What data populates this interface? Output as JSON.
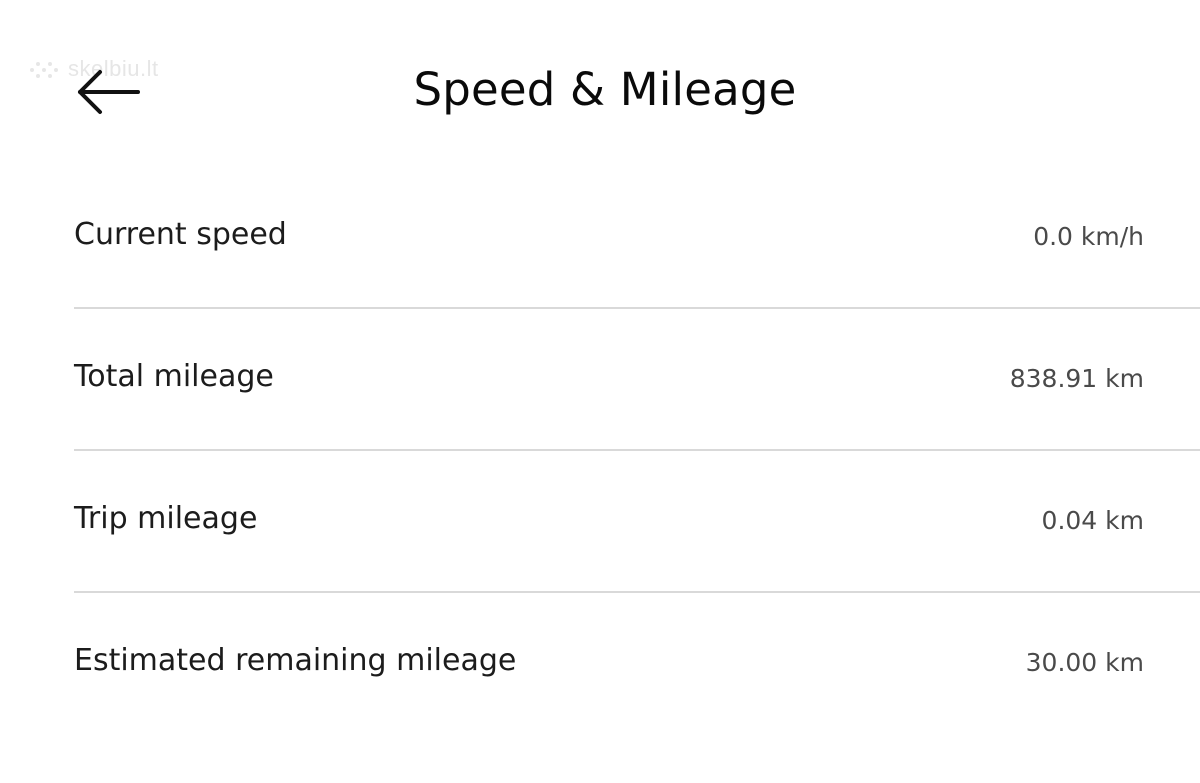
{
  "header": {
    "title": "Speed & Mileage",
    "back_icon": "arrow-left-icon",
    "watermark": "skelbiu.lt"
  },
  "rows": [
    {
      "label": "Current speed",
      "value": "0.0 km/h"
    },
    {
      "label": "Total mileage",
      "value": "838.91 km"
    },
    {
      "label": "Trip mileage",
      "value": "0.04 km"
    },
    {
      "label": "Estimated remaining mileage",
      "value": "30.00 km"
    }
  ],
  "colors": {
    "background": "#ffffff",
    "text_primary": "#111111",
    "text_secondary": "#4a4a4a",
    "divider": "#d9d9d9"
  }
}
